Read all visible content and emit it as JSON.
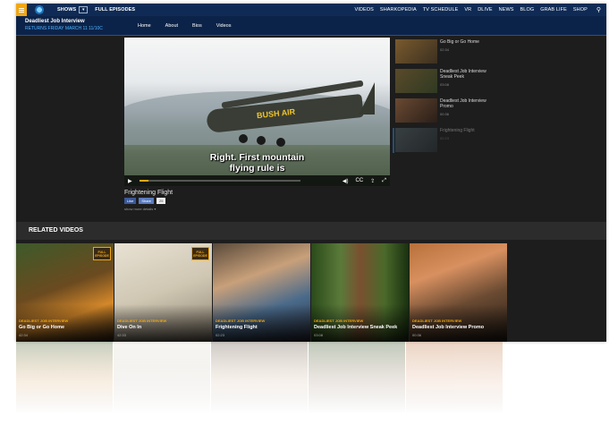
{
  "topbar": {
    "hamburger_icon": "menu-icon",
    "logo_icon": "discovery-globe-icon",
    "shows_label": "SHOWS",
    "shows_dropdown_icon": "chevron-down-icon",
    "full_episodes_label": "FULL EPISODES",
    "right_items": [
      "VIDEOS",
      "SHARKOPEDIA",
      "TV SCHEDULE",
      "VR",
      "DLIVE",
      "NEWS",
      "BLOG",
      "GRAB LIFE",
      "SHOP"
    ],
    "search_icon": "search-icon",
    "accent_color": "#f2a70f",
    "bar_color": "#0f2b55"
  },
  "show_header": {
    "title": "Deadliest Job Interview",
    "subtitle": "RETURNS FRIDAY MARCH 11 11/10C",
    "subnav": [
      "Home",
      "About",
      "Bios",
      "Videos"
    ]
  },
  "player": {
    "caption_line1": "Right. First mountain",
    "caption_line2": "flying rule is",
    "plane_text": "BUSH AIR",
    "progress": 0.06,
    "play_icon": "play-icon",
    "volume_icon": "volume-icon",
    "cc_label": "CC",
    "share_icon": "share-icon",
    "fullscreen_icon": "fullscreen-icon"
  },
  "video_info": {
    "title": "Frightening Flight",
    "like_label": "Like",
    "share_label": "Share",
    "count": "25",
    "show_more": "show more details ▾"
  },
  "sidebar": {
    "items": [
      {
        "title": "Go Big or Go Home",
        "duration": "02:34"
      },
      {
        "title": "Deadliest Job Interview Sneak Peek",
        "duration": "03:08"
      },
      {
        "title": "Deadliest Job Interview Promo",
        "duration": "00:36"
      },
      {
        "title": "Frightening Flight",
        "duration": "02:23"
      }
    ]
  },
  "related": {
    "heading": "RELATED VIDEOS",
    "badge_line1": "FULL",
    "badge_line2": "EPISODE",
    "cards": [
      {
        "show": "DEADLIEST JOB INTERVIEW",
        "title": "Go Big or Go Home",
        "duration": "42:34"
      },
      {
        "show": "DEADLIEST JOB INTERVIEW",
        "title": "Dive On In",
        "duration": "42:33"
      },
      {
        "show": "DEADLIEST JOB INTERVIEW",
        "title": "Frightening Flight",
        "duration": "02:23"
      },
      {
        "show": "DEADLIEST JOB INTERVIEW",
        "title": "Deadliest Job Interview Sneak Peek",
        "duration": "03:08"
      },
      {
        "show": "DEADLIEST JOB INTERVIEW",
        "title": "Deadliest Job Interview Promo",
        "duration": "00:36"
      }
    ]
  }
}
